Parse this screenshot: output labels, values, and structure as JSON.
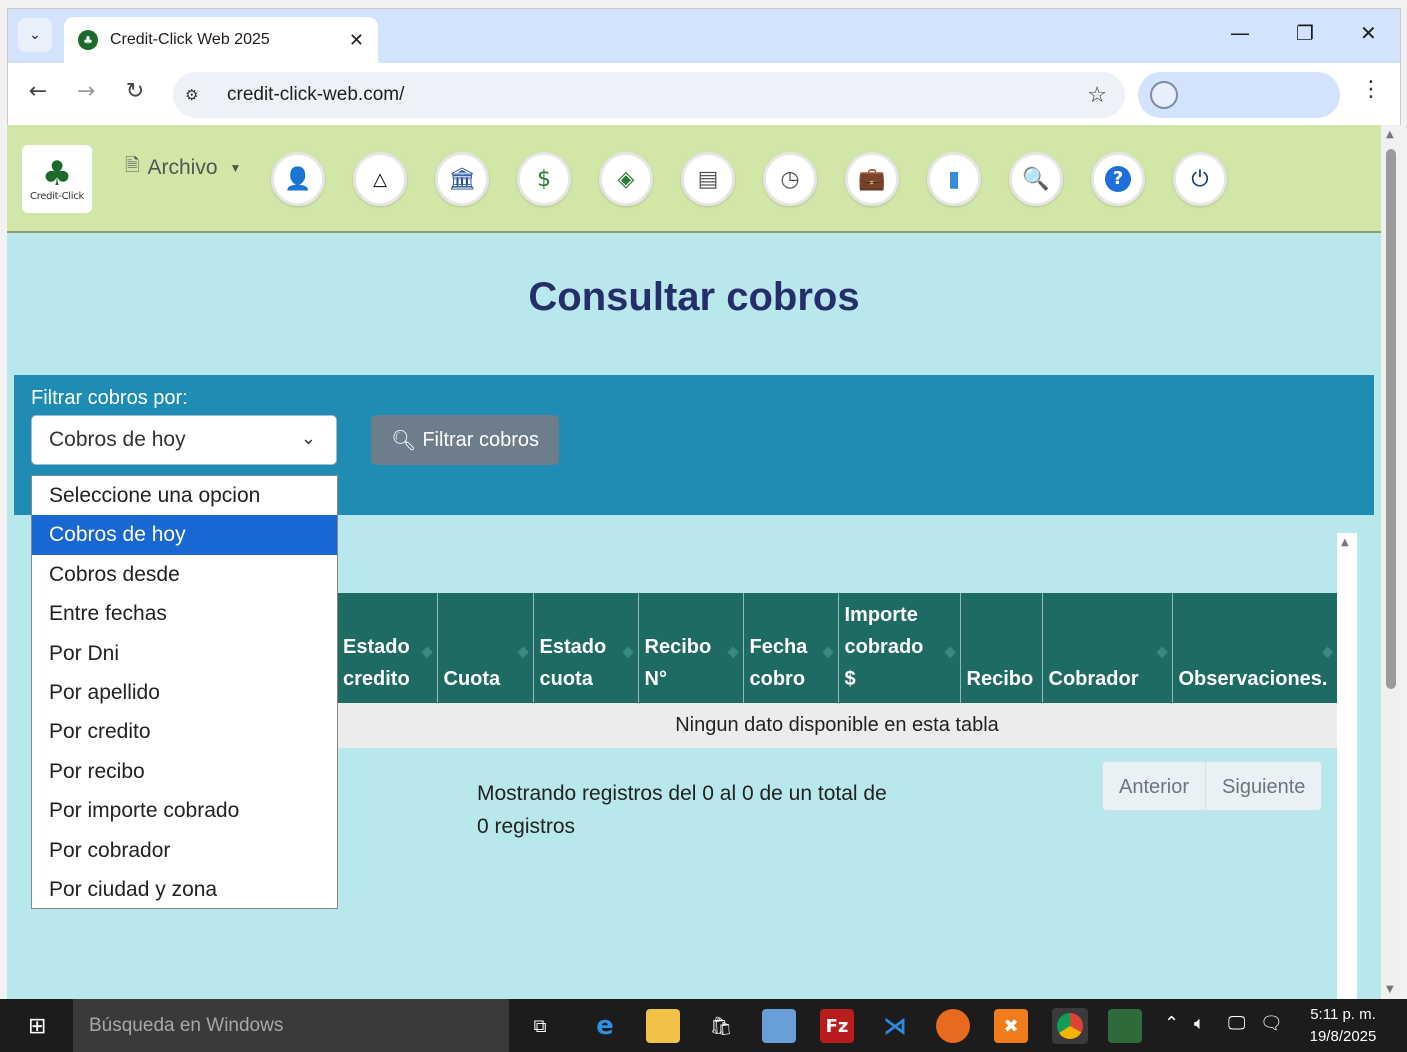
{
  "browser": {
    "tab_title": "Credit-Click Web 2025",
    "url": "credit-click-web.com/"
  },
  "app": {
    "logo_text": "Credit-Click",
    "menu_archivo": "Archivo",
    "toolbar_icons": [
      "person-icon",
      "shapes-icon",
      "bank-icon",
      "money-chart-icon",
      "money-hand-icon",
      "calculator-icon",
      "clock-icon",
      "briefcase-icon",
      "bar-chart-icon",
      "search-icon",
      "help-icon",
      "power-icon"
    ]
  },
  "page": {
    "title": "Consultar cobros"
  },
  "filter": {
    "label": "Filtrar cobros por:",
    "selected": "Cobros de hoy",
    "button_label": "Filtrar cobros",
    "options": [
      "Seleccione una opcion",
      "Cobros de hoy",
      "Cobros desde",
      "Entre fechas",
      "Por Dni",
      "Por apellido",
      "Por credito",
      "Por recibo",
      "Por importe cobrado",
      "Por cobrador",
      "Por ciudad y zona"
    ]
  },
  "table": {
    "columns": [
      [
        "Estado",
        "credito"
      ],
      [
        "Cuota"
      ],
      [
        "Estado",
        "cuota"
      ],
      [
        "Recibo",
        "N°"
      ],
      [
        "Fecha",
        "cobro"
      ],
      [
        "Importe",
        "cobrado",
        "$"
      ],
      [
        "Recibo"
      ],
      [
        "Cobrador"
      ],
      [
        "Observaciones."
      ]
    ],
    "empty_message": "Ningun dato disponible en esta tabla",
    "info": "Mostrando registros del 0 al 0 de un total de 0 registros",
    "prev_label": "Anterior",
    "next_label": "Siguiente"
  },
  "taskbar": {
    "search_placeholder": "Búsqueda en Windows",
    "time": "5:11 p. m.",
    "date": "19/8/2025"
  }
}
